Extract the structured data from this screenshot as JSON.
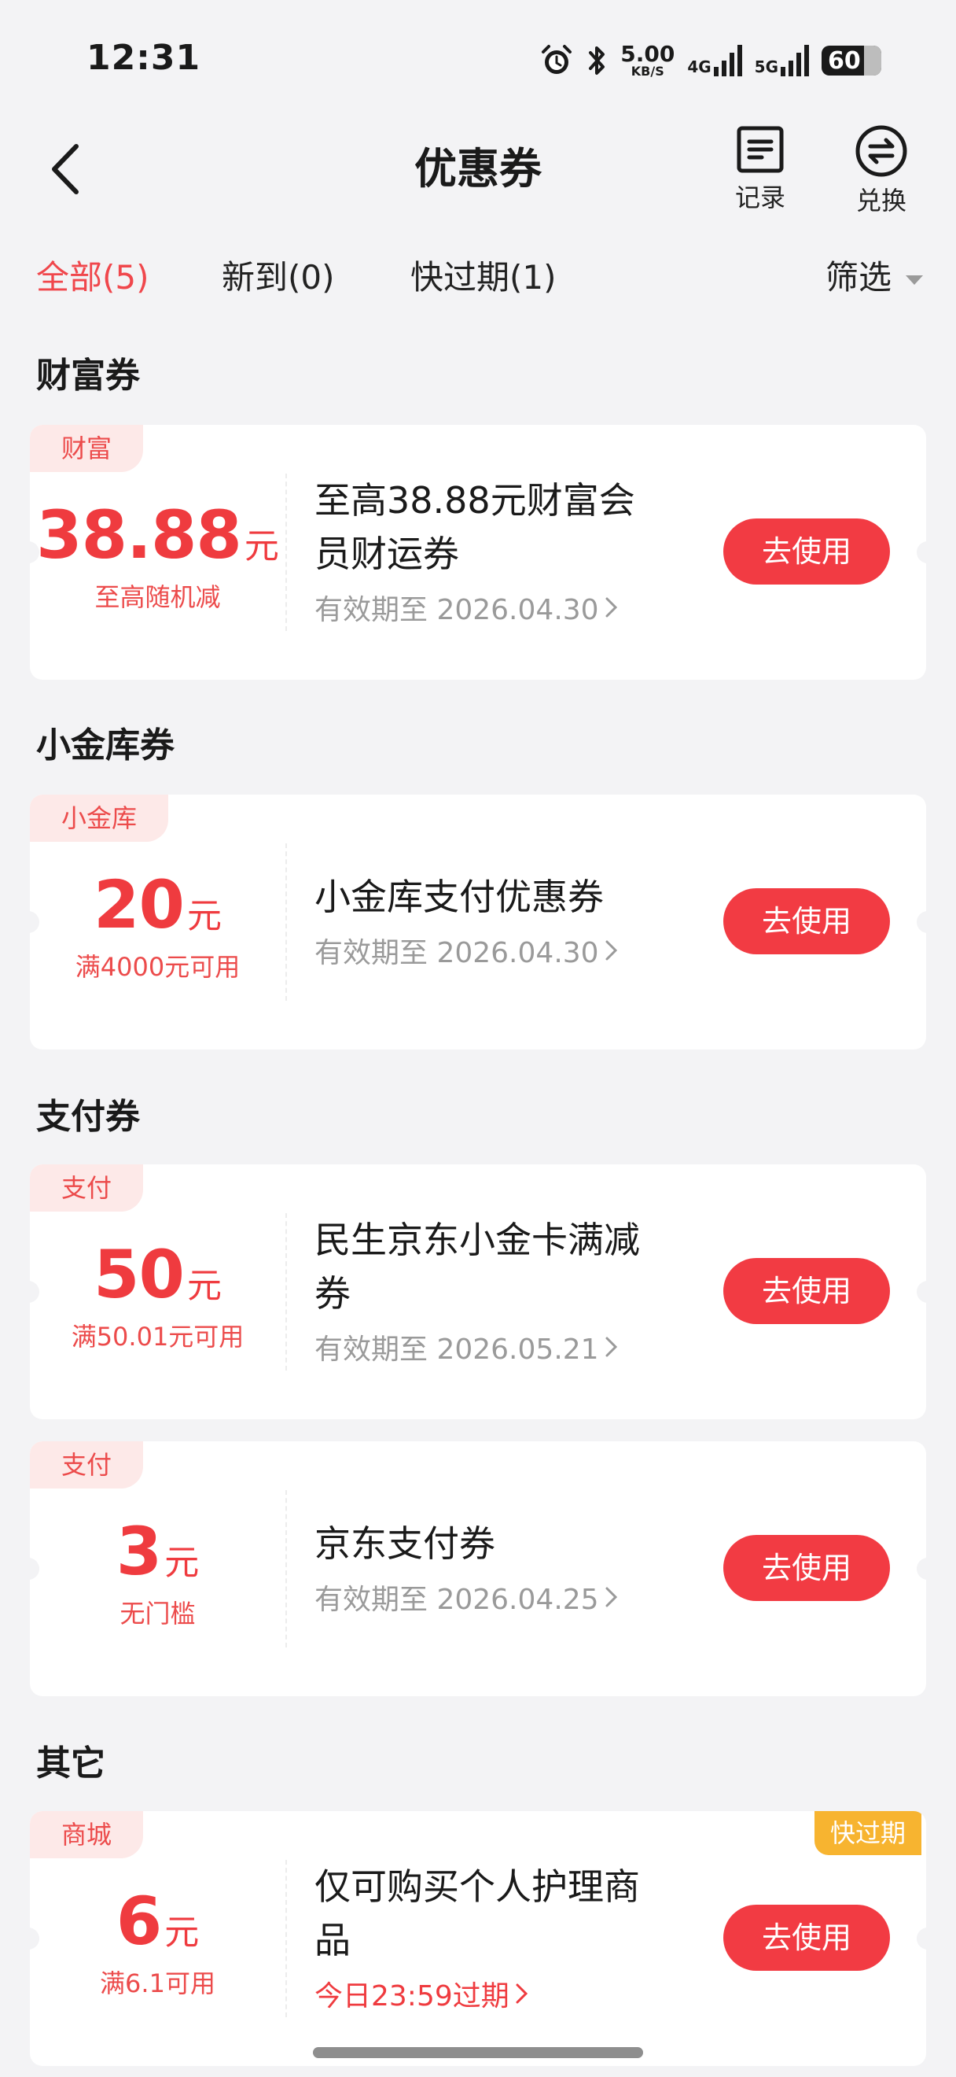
{
  "status_bar": {
    "time": "12:31",
    "net_speed_value": "5.00",
    "net_speed_unit": "KB/S",
    "sim1_label": "4G",
    "sim2_label": "5G",
    "battery": "60",
    "icons": [
      "alarm-icon",
      "bluetooth-icon",
      "signal-icon",
      "battery-icon"
    ]
  },
  "header": {
    "title": "优惠券",
    "record_label": "记录",
    "exchange_label": "兑换"
  },
  "tabs": [
    {
      "label": "全部(5)",
      "active": true
    },
    {
      "label": "新到(0)",
      "active": false
    },
    {
      "label": "快过期(1)",
      "active": false
    }
  ],
  "filter_label": "筛选",
  "sections": [
    {
      "title": "财富券",
      "cards": [
        {
          "tag": "财富",
          "amount": "38.88",
          "unit": "元",
          "condition": "至高随机减",
          "name_lines": [
            "至高38.88元财富会",
            "员财运券"
          ],
          "validity": "有效期至 2026.04.30",
          "button": "去使用"
        }
      ]
    },
    {
      "title": "小金库券",
      "cards": [
        {
          "tag": "小金库",
          "amount": "20",
          "unit": "元",
          "condition": "满4000元可用",
          "name_lines": [
            "小金库支付优惠券"
          ],
          "validity": "有效期至 2026.04.30",
          "button": "去使用"
        }
      ]
    },
    {
      "title": "支付券",
      "cards": [
        {
          "tag": "支付",
          "amount": "50",
          "unit": "元",
          "condition": "满50.01元可用",
          "name_lines": [
            "民生京东小金卡满减",
            "券"
          ],
          "validity": "有效期至 2026.05.21",
          "button": "去使用"
        },
        {
          "tag": "支付",
          "amount": "3",
          "unit": "元",
          "condition": "无门槛",
          "name_lines": [
            "京东支付券"
          ],
          "validity": "有效期至 2026.04.25",
          "button": "去使用"
        }
      ]
    },
    {
      "title": "其它",
      "cards": [
        {
          "tag": "商城",
          "amount": "6",
          "unit": "元",
          "condition": "满6.1可用",
          "name_lines": [
            "仅可购买个人护理商",
            "品"
          ],
          "validity": "今日23:59过期",
          "button": "去使用",
          "badge": "快过期"
        }
      ]
    }
  ],
  "colors": {
    "accent": "#f23b43",
    "amount": "#ef3b3f",
    "tag_bg": "#fde9e8",
    "urgent_badge": "#f7b430",
    "page_bg": "#f3f3f5"
  }
}
